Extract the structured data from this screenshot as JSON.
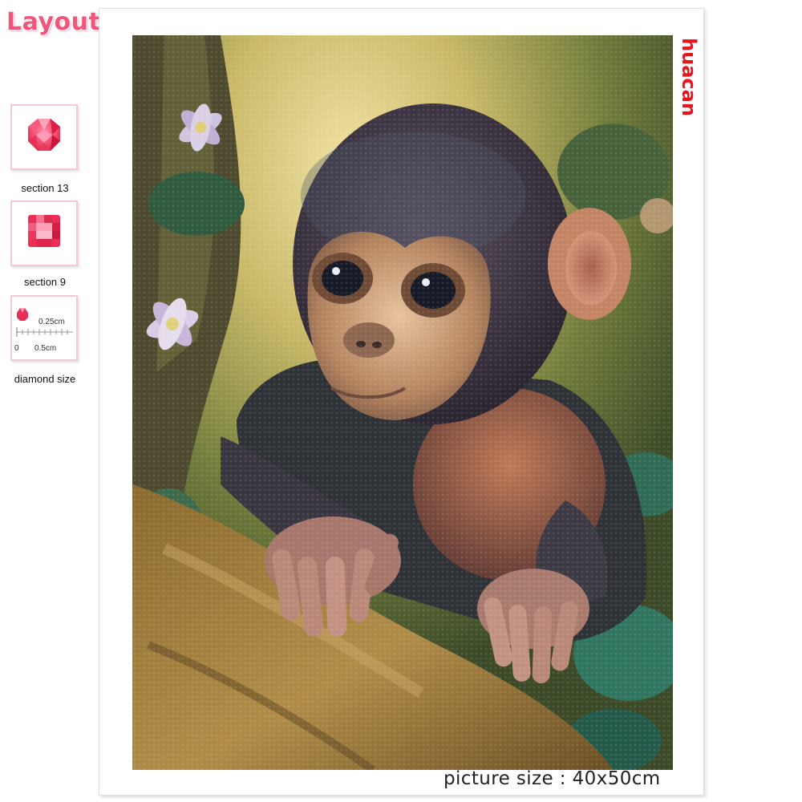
{
  "header": {
    "layout_label": "Layout"
  },
  "swatches": [
    {
      "label": "section 13",
      "shape": "round-diamond-icon",
      "color": "#ef4165"
    },
    {
      "label": "section 9",
      "shape": "square-diamond-icon",
      "color": "#ef4165"
    }
  ],
  "diamond_size": {
    "label": "diamond size",
    "drill_width": "0.25cm",
    "ruler_start": "0",
    "ruler_mark": "0.5cm"
  },
  "artwork": {
    "brand": "huacan",
    "caption": "picture size : 40x50cm",
    "subject": "baby-monkey-on-branch"
  },
  "colors": {
    "accent_pink": "#f2557c",
    "brand_red": "#e8151f",
    "frame_border": "#f4c9d6"
  }
}
